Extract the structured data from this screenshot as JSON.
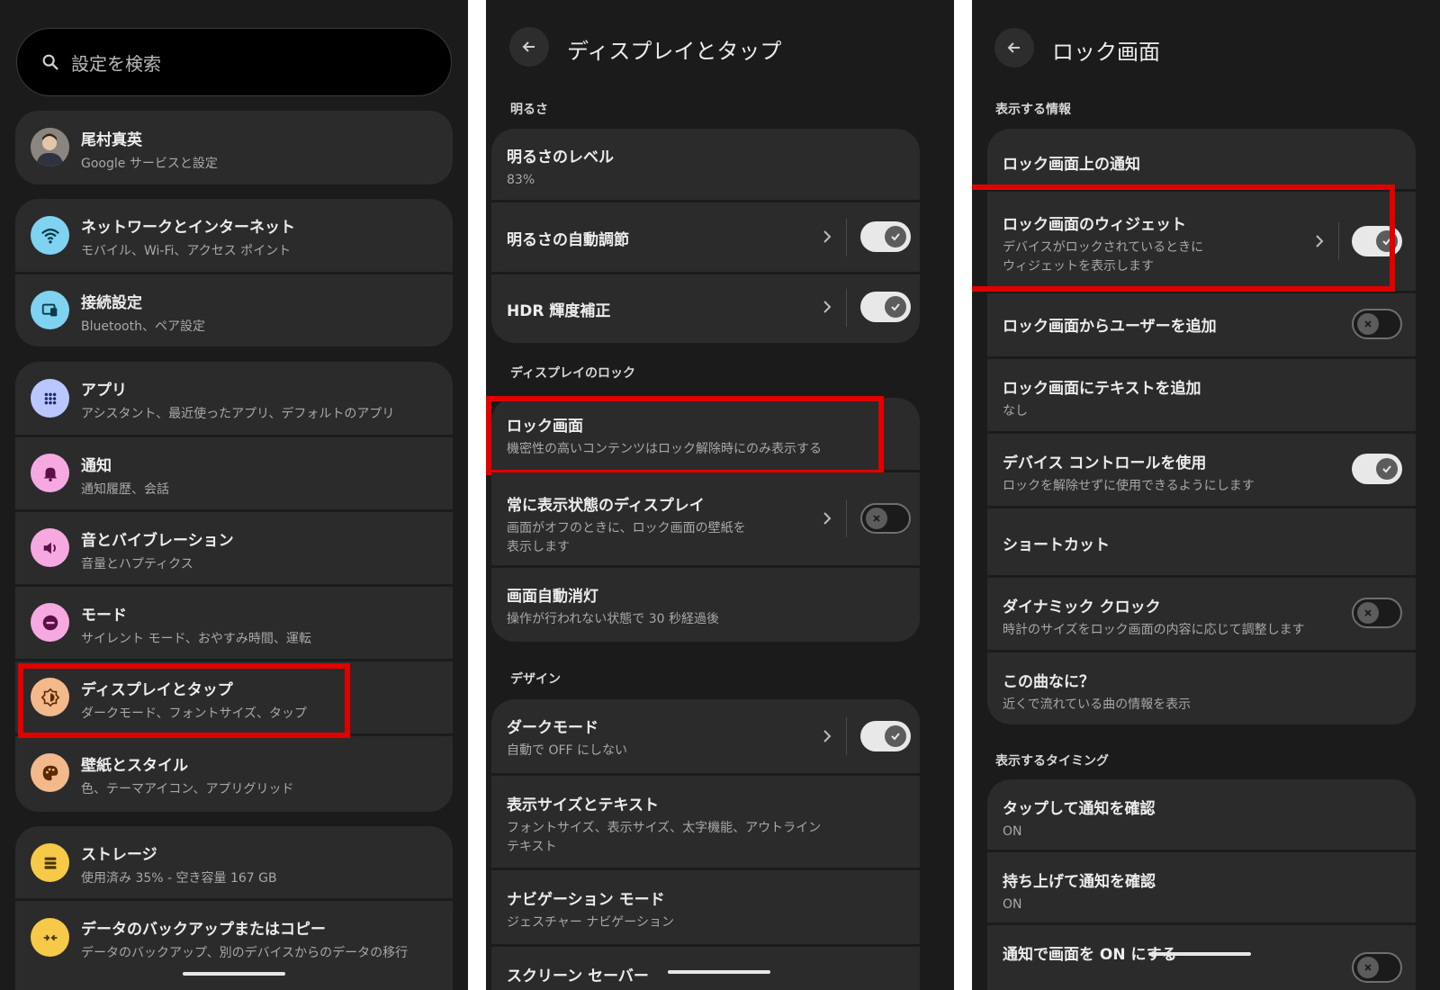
{
  "panel1": {
    "search_placeholder": "設定を検索",
    "account": {
      "name": "尾村真英",
      "subtitle": "Google サービスと設定"
    },
    "items": [
      {
        "title": "ネットワークとインターネット",
        "subtitle": "モバイル、Wi-Fi、アクセス ポイント",
        "icon": "wifi-icon",
        "color": "#7fd3f0"
      },
      {
        "title": "接続設定",
        "subtitle": "Bluetooth、ペア設定",
        "icon": "connected-devices-icon",
        "color": "#7fd3f0"
      },
      {
        "title": "アプリ",
        "subtitle": "アシスタント、最近使ったアプリ、デフォルトのアプリ",
        "icon": "apps-grid-icon",
        "color": "#b9c6ff"
      },
      {
        "title": "通知",
        "subtitle": "通知履歴、会話",
        "icon": "bell-icon",
        "color": "#f5a9e0"
      },
      {
        "title": "音とバイブレーション",
        "subtitle": "音量とハプティクス",
        "icon": "volume-icon",
        "color": "#f5a9e0"
      },
      {
        "title": "モード",
        "subtitle": "サイレント モード、おやすみ時間、運転",
        "icon": "do-not-disturb-icon",
        "color": "#f5a9e0"
      },
      {
        "title": "ディスプレイとタップ",
        "subtitle": "ダークモード、フォントサイズ、タップ",
        "icon": "display-brightness-icon",
        "color": "#f4b98a"
      },
      {
        "title": "壁紙とスタイル",
        "subtitle": "色、テーマアイコン、アプリグリッド",
        "icon": "palette-icon",
        "color": "#f4b98a"
      },
      {
        "title": "ストレージ",
        "subtitle": "使用済み 35% - 空き容量 167 GB",
        "icon": "storage-icon",
        "color": "#f7c948"
      },
      {
        "title": "データのバックアップまたはコピー",
        "subtitle": "データのバックアップ、別のデバイスからのデータの移行",
        "icon": "backup-transfer-icon",
        "color": "#f7c948"
      }
    ]
  },
  "panel2": {
    "title": "ディスプレイとタップ",
    "sections": {
      "brightness": "明るさ",
      "lock": "ディスプレイのロック",
      "design": "デザイン"
    },
    "items": {
      "brightness_level": {
        "title": "明るさのレベル",
        "subtitle": "83%"
      },
      "adaptive_brightness": {
        "title": "明るさの自動調節",
        "toggle": true
      },
      "hdr": {
        "title": "HDR 輝度補正",
        "toggle": true
      },
      "lock_screen": {
        "title": "ロック画面",
        "subtitle": "機密性の高いコンテンツはロック解除時にのみ表示する"
      },
      "always_on": {
        "title": "常に表示状態のディスプレイ",
        "subtitle1": "画面がオフのときに、ロック画面の壁紙を",
        "subtitle2": "表示します",
        "toggle": false
      },
      "screen_timeout": {
        "title": "画面自動消灯",
        "subtitle": "操作が行われない状態で 30 秒経過後"
      },
      "dark_mode": {
        "title": "ダークモード",
        "subtitle": "自動で OFF にしない",
        "toggle": true
      },
      "display_size": {
        "title": "表示サイズとテキスト",
        "subtitle1": "フォントサイズ、表示サイズ、太字機能、アウトライン",
        "subtitle2": "テキスト"
      },
      "navigation": {
        "title": "ナビゲーション モード",
        "subtitle": "ジェスチャー ナビゲーション"
      },
      "screensaver": {
        "title": "スクリーン セーバー"
      }
    }
  },
  "panel3": {
    "title": "ロック画面",
    "sections": {
      "info": "表示する情報",
      "timing": "表示するタイミング"
    },
    "items": {
      "notifications": {
        "title": "ロック画面上の通知"
      },
      "widgets": {
        "title": "ロック画面のウィジェット",
        "subtitle1": "デバイスがロックされているときに",
        "subtitle2": "ウィジェットを表示します",
        "toggle": true
      },
      "add_users": {
        "title": "ロック画面からユーザーを追加",
        "toggle": false
      },
      "add_text": {
        "title": "ロック画面にテキストを追加",
        "subtitle": "なし"
      },
      "device_controls": {
        "title": "デバイス コントロールを使用",
        "subtitle": "ロックを解除せずに使用できるようにします",
        "toggle": true
      },
      "shortcuts": {
        "title": "ショートカット"
      },
      "dynamic_clock": {
        "title": "ダイナミック クロック",
        "subtitle": "時計のサイズをロック画面の内容に応じて調整します",
        "toggle": false
      },
      "now_playing": {
        "title": "この曲なに？",
        "subtitle": "近くで流れている曲の情報を表示"
      },
      "tap_check": {
        "title": "タップして通知を確認",
        "subtitle": "ON"
      },
      "lift_check": {
        "title": "持ち上げて通知を確認",
        "subtitle": "ON"
      },
      "wake_on_notify": {
        "title": "通知で画面を ON にする"
      }
    }
  }
}
